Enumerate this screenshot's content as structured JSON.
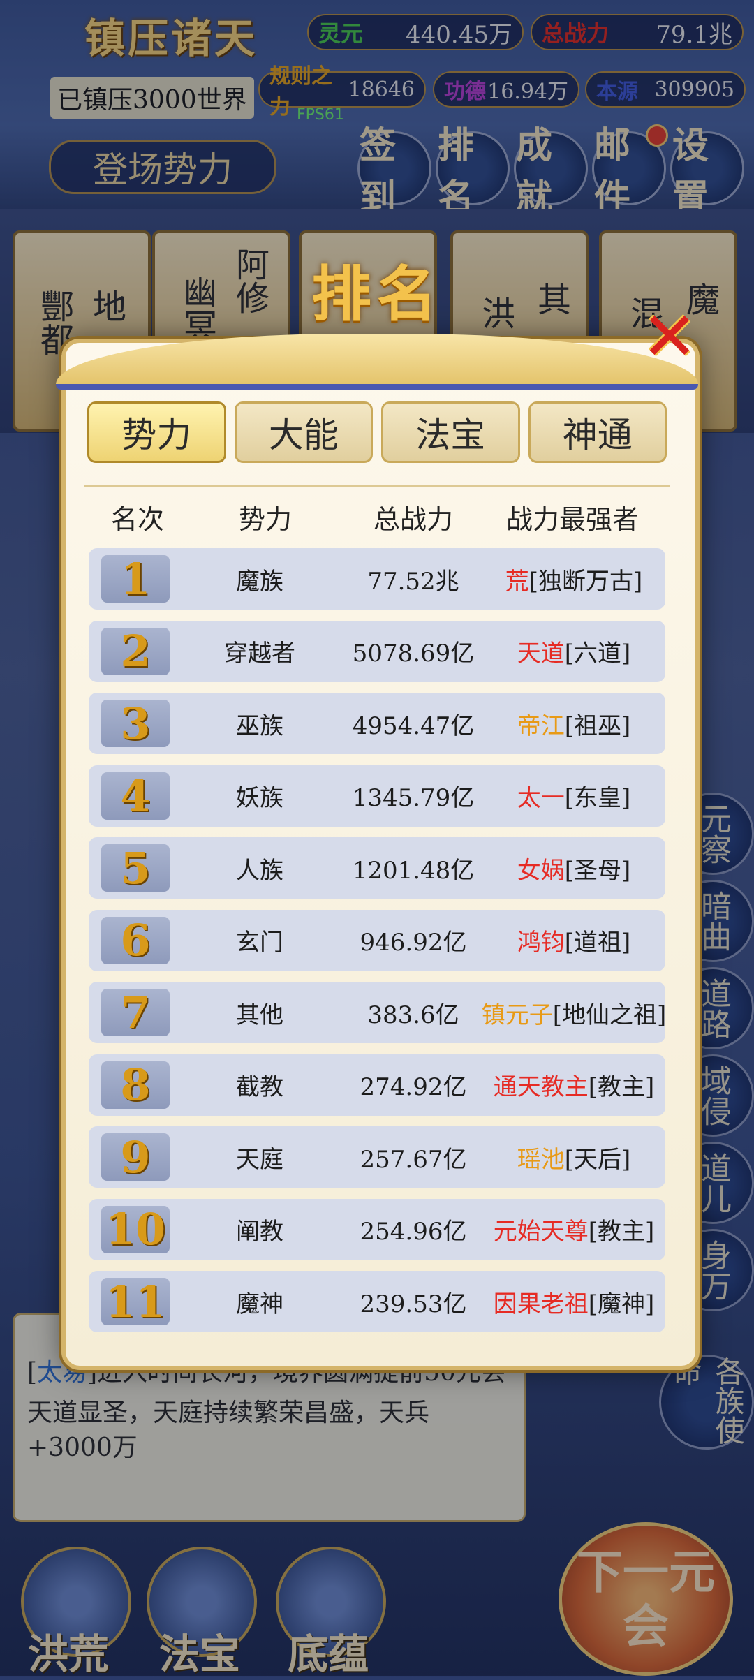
{
  "game": {
    "title": "镇压诸天",
    "suppressed": "已镇压3000世界",
    "fps": "FPS61",
    "enter_faction": "登场势力",
    "resources": [
      {
        "label": "灵元",
        "value": "440.45万",
        "color": "#49c94a"
      },
      {
        "label": "总战力",
        "value": "79.1兆",
        "color": "#e02a1f"
      },
      {
        "label": "规则之力",
        "value": "18646",
        "color": "#e4a21b"
      },
      {
        "label": "功德",
        "value": "16.94万",
        "color": "#b63fd0"
      },
      {
        "label": "本源",
        "value": "309905",
        "color": "#3f58d6"
      }
    ],
    "top_buttons": [
      "签到",
      "排名",
      "成就",
      "邮件",
      "设置"
    ],
    "faction_cards": [
      "酆都",
      "地",
      "幽冥",
      "阿修",
      "洪",
      "其",
      "混",
      "魔"
    ],
    "side_buttons": [
      "元察",
      "暗曲",
      "道路",
      "域侵",
      "道儿",
      "身万",
      "各族使命"
    ],
    "log": {
      "line1_name": "太易",
      "line1_text": "进入时间长河，境界圆满提前50元会",
      "line2_text": "天道显圣，天庭持续繁荣昌盛，天兵+3000万"
    },
    "bottom_buttons": [
      "洪荒",
      "法宝",
      "底蕴"
    ],
    "next_era": "下一元会"
  },
  "modal": {
    "title": "排名",
    "close_icon": "close-x-icon",
    "tabs": [
      "势力",
      "大能",
      "法宝",
      "神通"
    ],
    "active_tab": 0,
    "columns": [
      "名次",
      "势力",
      "总战力",
      "战力最强者"
    ],
    "rows": [
      {
        "rank": "1",
        "faction": "魔族",
        "power": "77.52兆",
        "leader": "荒",
        "leader_title": "[独断万古]",
        "leader_color": "red"
      },
      {
        "rank": "2",
        "faction": "穿越者",
        "power": "5078.69亿",
        "leader": "天道",
        "leader_title": "[六道]",
        "leader_color": "red"
      },
      {
        "rank": "3",
        "faction": "巫族",
        "power": "4954.47亿",
        "leader": "帝江",
        "leader_title": "[祖巫]",
        "leader_color": "orange"
      },
      {
        "rank": "4",
        "faction": "妖族",
        "power": "1345.79亿",
        "leader": "太一",
        "leader_title": "[东皇]",
        "leader_color": "red"
      },
      {
        "rank": "5",
        "faction": "人族",
        "power": "1201.48亿",
        "leader": "女娲",
        "leader_title": "[圣母]",
        "leader_color": "red"
      },
      {
        "rank": "6",
        "faction": "玄门",
        "power": "946.92亿",
        "leader": "鸿钧",
        "leader_title": "[道祖]",
        "leader_color": "red"
      },
      {
        "rank": "7",
        "faction": "其他",
        "power": "383.6亿",
        "leader": "镇元子",
        "leader_title": "[地仙之祖]",
        "leader_color": "orange"
      },
      {
        "rank": "8",
        "faction": "截教",
        "power": "274.92亿",
        "leader": "通天教主",
        "leader_title": "[教主]",
        "leader_color": "red"
      },
      {
        "rank": "9",
        "faction": "天庭",
        "power": "257.67亿",
        "leader": "瑶池",
        "leader_title": "[天后]",
        "leader_color": "orange"
      },
      {
        "rank": "10",
        "faction": "阐教",
        "power": "254.96亿",
        "leader": "元始天尊",
        "leader_title": "[教主]",
        "leader_color": "red"
      },
      {
        "rank": "11",
        "faction": "魔神",
        "power": "239.53亿",
        "leader": "因果老祖",
        "leader_title": "[魔神]",
        "leader_color": "red"
      }
    ]
  }
}
